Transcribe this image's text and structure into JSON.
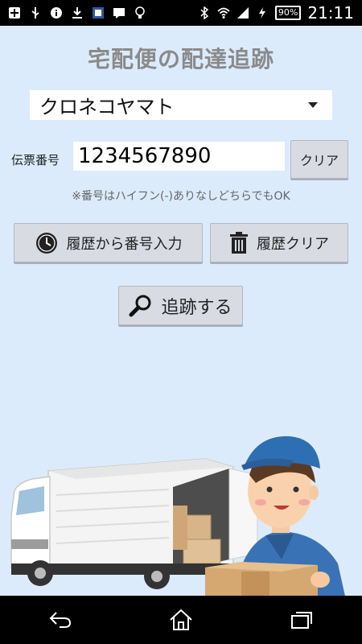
{
  "status_bar": {
    "battery": "90%",
    "time": "21:11"
  },
  "title": "宅配便の配達追跡",
  "carrier": {
    "selected": "クロネコヤマト"
  },
  "tracking": {
    "label": "伝票番号",
    "value": "1234567890",
    "clear_label": "クリア",
    "note": "※番号はハイフン(-)ありなしどちらでもOK"
  },
  "buttons": {
    "history_input": "履歴から番号入力",
    "history_clear": "履歴クリア",
    "track": "追跡する"
  },
  "icons": {
    "history": "clock-icon",
    "delete": "trash-icon",
    "search": "search-icon"
  },
  "colors": {
    "background": "#dcebfb",
    "button": "#d8dce2",
    "title": "#8a8a8a"
  }
}
